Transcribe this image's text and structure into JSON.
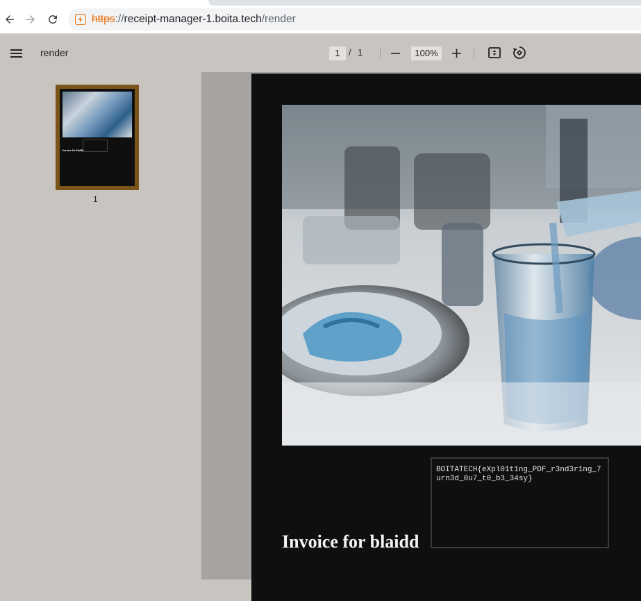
{
  "browser": {
    "url_scheme": "https",
    "url_sep": "://",
    "url_host": "receipt-manager-1.boita.tech",
    "url_path": "/render",
    "back_icon": "arrow-left-icon",
    "forward_icon": "arrow-right-icon",
    "reload_icon": "reload-icon",
    "site_icon": "not-secure-icon"
  },
  "toolbar": {
    "title": "render",
    "current_page": "1",
    "page_sep": "/",
    "total_pages": "1",
    "zoom": "100%",
    "menu_icon": "menu-icon",
    "zoom_out_icon": "minus-icon",
    "zoom_in_icon": "plus-icon",
    "fit_icon": "fit-to-page-icon",
    "rotate_icon": "rotate-icon"
  },
  "sidebar": {
    "thumbnails": [
      {
        "label": "1",
        "selected": true
      }
    ]
  },
  "document": {
    "flag": "BOITATECH{eXpl01t1ng_PDF_r3nd3r1ng_7urn3d_0u7_t0_b3_34sy}",
    "title": "Invoice for blaidd"
  },
  "colors": {
    "accent_border": "#7a5418",
    "page_bg": "#0f0f10",
    "viewer_bg": "#c8c4c0",
    "doc_area_bg": "#a7a3a1"
  }
}
